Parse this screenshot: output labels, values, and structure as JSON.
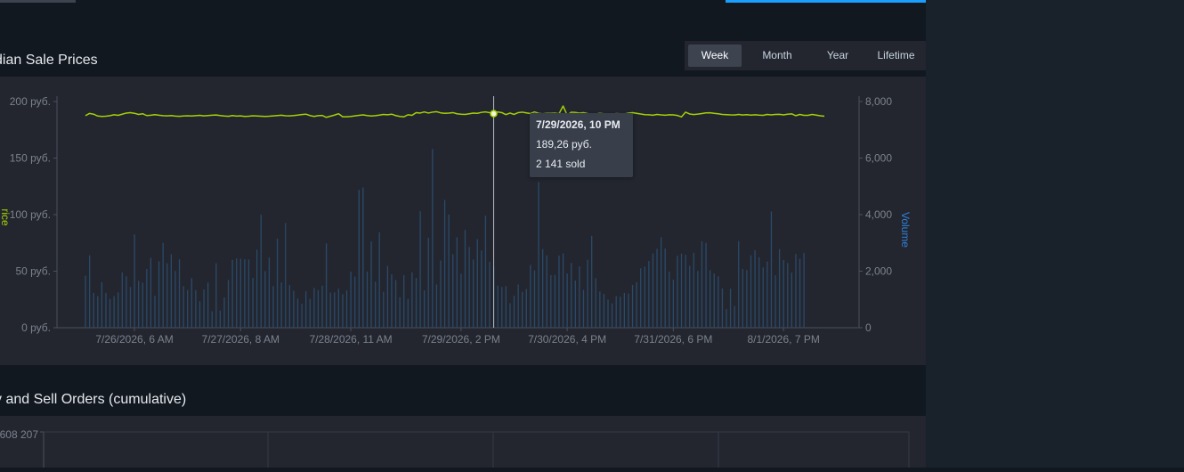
{
  "colors": {
    "price_line": "#a4d007",
    "volume_bar": "#2a4a6a",
    "volume_label": "#2f7fd6",
    "axis": "#4a505b",
    "tick_text": "#7b828c"
  },
  "sections": {
    "price_title": "dian Sale Prices",
    "orders_title": "y and Sell Orders (cumulative)"
  },
  "range_tabs": [
    {
      "label": "Week",
      "active": true
    },
    {
      "label": "Month",
      "active": false
    },
    {
      "label": "Year",
      "active": false
    },
    {
      "label": "Lifetime",
      "active": false
    }
  ],
  "tooltip": {
    "date": "7/29/2026, 10 PM",
    "price": "189,26 руб.",
    "sold": "2 141 sold"
  },
  "chart_data": [
    {
      "type": "line",
      "title": "dian Sale Prices",
      "ylabel": "rice",
      "y2label": "Volume",
      "ylim": [
        0,
        200
      ],
      "y2lim": [
        0,
        8000
      ],
      "y_ticks": [
        {
          "v": 0,
          "label": "0 руб."
        },
        {
          "v": 50,
          "label": "50 руб."
        },
        {
          "v": 100,
          "label": "100 руб."
        },
        {
          "v": 150,
          "label": "150 руб."
        },
        {
          "v": 200,
          "label": "200 руб."
        }
      ],
      "y2_ticks": [
        {
          "v": 0,
          "label": "0"
        },
        {
          "v": 2000,
          "label": "2,000"
        },
        {
          "v": 4000,
          "label": "4,000"
        },
        {
          "v": 6000,
          "label": "6,000"
        },
        {
          "v": 8000,
          "label": "8,000"
        }
      ],
      "x_ticks": [
        {
          "i": 12,
          "label": "7/26/2026, 6 AM"
        },
        {
          "i": 38,
          "label": "7/27/2026, 8 AM"
        },
        {
          "i": 65,
          "label": "7/28/2026, 11 AM"
        },
        {
          "i": 92,
          "label": "7/29/2026, 2 PM"
        },
        {
          "i": 118,
          "label": "7/30/2026, 4 PM"
        },
        {
          "i": 144,
          "label": "7/31/2026, 6 PM"
        },
        {
          "i": 171,
          "label": "8/1/2026, 7 PM"
        }
      ],
      "hover_index": 100,
      "series": [
        {
          "kind": "line",
          "axis": "price",
          "values": [
            187.5,
            189.5,
            188.8,
            187.2,
            186.8,
            187.0,
            187.5,
            188.3,
            187.8,
            188.8,
            189.8,
            190.2,
            189.6,
            188.6,
            189.2,
            187.6,
            187.9,
            188.4,
            187.9,
            187.5,
            187.3,
            187.6,
            187.1,
            186.9,
            187.2,
            187.4,
            187.2,
            187.5,
            187.8,
            187.3,
            187.6,
            187.9,
            188.1,
            187.6,
            187.2,
            186.9,
            187.6,
            187.1,
            187.3,
            186.8,
            187.0,
            187.4,
            187.2,
            187.0,
            186.8,
            187.0,
            187.3,
            187.6,
            187.9,
            187.4,
            187.3,
            187.6,
            188.0,
            188.5,
            188.8,
            187.6,
            186.8,
            187.5,
            187.7,
            186.0,
            187.0,
            188.0,
            189.2,
            186.5,
            186.5,
            186.8,
            187.3,
            187.8,
            188.2,
            187.6,
            187.2,
            187.5,
            188.0,
            188.6,
            188.3,
            188.8,
            187.6,
            186.8,
            186.5,
            188.3,
            187.8,
            190.2,
            189.8,
            190.8,
            189.8,
            190.6,
            191.0,
            190.0,
            189.6,
            189.8,
            190.2,
            189.2,
            188.8,
            188.6,
            189.2,
            189.8,
            189.6,
            190.4,
            190.8,
            190.2,
            189.26,
            190.8,
            190.2,
            188.4,
            189.8,
            188.6,
            190.2,
            190.6,
            190.0,
            189.4,
            190.8,
            189.6,
            189.2,
            189.6,
            189.6,
            189.8,
            189.2,
            196.0,
            188.0,
            190.6,
            190.4,
            189.8,
            190.2,
            189.4,
            188.8,
            189.0,
            189.6,
            189.2,
            189.0,
            188.4,
            189.4,
            189.2,
            189.0,
            189.8,
            190.2,
            189.6,
            189.0,
            188.4,
            188.3,
            187.9,
            188.6,
            188.2,
            187.9,
            188.3,
            188.2,
            187.7,
            186.4,
            190.6,
            189.0,
            188.5,
            188.9,
            189.4,
            190.0,
            190.1,
            189.6,
            189.2,
            188.6,
            188.4,
            188.2,
            188.1,
            188.6,
            188.1,
            188.4,
            188.0,
            188.3,
            188.0,
            187.8,
            188.6,
            188.2,
            188.6,
            188.7,
            188.2,
            188.8,
            189.1,
            187.5,
            188.6,
            187.8,
            187.8,
            188.6,
            188.0,
            187.4,
            187.0
          ]
        },
        {
          "kind": "bar",
          "axis": "volume",
          "values": [
            1840,
            2560,
            1230,
            1120,
            1610,
            1230,
            1020,
            1120,
            1250,
            1960,
            1820,
            1440,
            3300,
            1660,
            1590,
            2080,
            2470,
            1130,
            2350,
            3000,
            2280,
            2600,
            2010,
            2420,
            1470,
            1330,
            1760,
            1330,
            940,
            1350,
            1600,
            580,
            2280,
            610,
            1070,
            1690,
            2400,
            2450,
            2440,
            2420,
            2410,
            1760,
            2760,
            4000,
            2000,
            2480,
            1470,
            3150,
            1600,
            3700,
            1510,
            1310,
            1030,
            850,
            1290,
            1020,
            1410,
            1330,
            1490,
            2980,
            1240,
            1250,
            1380,
            1180,
            1320,
            1980,
            1810,
            4880,
            4960,
            1990,
            3050,
            1630,
            3380,
            1270,
            2190,
            1890,
            1690,
            1080,
            1860,
            1020,
            1960,
            1760,
            4120,
            1320,
            3180,
            6320,
            1530,
            2380,
            4520,
            4010,
            2600,
            3200,
            1910,
            3460,
            2860,
            2410,
            3130,
            2730,
            3960,
            2330,
            2141,
            1490,
            1440,
            1470,
            870,
            1130,
            1530,
            1270,
            1370,
            2220,
            2030,
            5160,
            2780,
            2560,
            1860,
            1870,
            2550,
            2630,
            1920,
            2290,
            1670,
            2170,
            1340,
            2400,
            3250,
            1750,
            1280,
            1200,
            1000,
            860,
            1120,
            1100,
            1230,
            1210,
            1510,
            1610,
            2100,
            2160,
            2360,
            2630,
            2790,
            3200,
            2800,
            1980,
            1700,
            2540,
            2620,
            2580,
            2190,
            2650,
            2010,
            3060,
            3000,
            2030,
            1920,
            1820,
            1390,
            660,
            1380,
            770,
            3060,
            2080,
            2040,
            2560,
            2740,
            2490,
            2130,
            2340,
            4110,
            1850,
            2780,
            2400,
            2290,
            1950,
            2610,
            2440,
            2650
          ]
        }
      ]
    },
    {
      "type": "line",
      "title": "y and Sell Orders (cumulative)",
      "y_ticks": [
        {
          "label": "608 207"
        }
      ]
    }
  ]
}
